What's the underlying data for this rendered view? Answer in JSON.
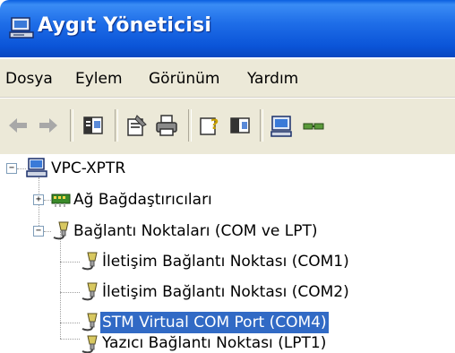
{
  "window": {
    "title": "Aygıt Yöneticisi",
    "title_icon": "computer-icon"
  },
  "menu": {
    "items": [
      "Dosya",
      "Eylem",
      "Görünüm",
      "Yardım"
    ]
  },
  "toolbar": {
    "buttons": [
      "back-arrow-icon",
      "forward-arrow-icon",
      "show-hide-console-tree-icon",
      "properties-icon",
      "print-icon",
      "help-icon",
      "show-action-pane-icon",
      "computer-icon",
      "network-icon"
    ]
  },
  "tree": {
    "root": {
      "expander": "−",
      "label": "VPC-XPTR"
    },
    "children": [
      {
        "expander": "+",
        "label": "Ağ Bağdaştırıcıları"
      },
      {
        "expander": "−",
        "label": "Bağlantı Noktaları (COM ve LPT)"
      }
    ],
    "ports": [
      {
        "label": "İletişim Bağlantı Noktası (COM1)",
        "selected": false
      },
      {
        "label": "İletişim Bağlantı Noktası (COM2)",
        "selected": false
      },
      {
        "label": "STM Virtual COM Port (COM4)",
        "selected": true
      },
      {
        "label": "Yazıcı Bağlantı Noktası (LPT1)",
        "selected": false
      }
    ]
  },
  "colors": {
    "titlebar": "#1f6ee8",
    "selection": "#316ac5",
    "chrome": "#ece9d8"
  }
}
